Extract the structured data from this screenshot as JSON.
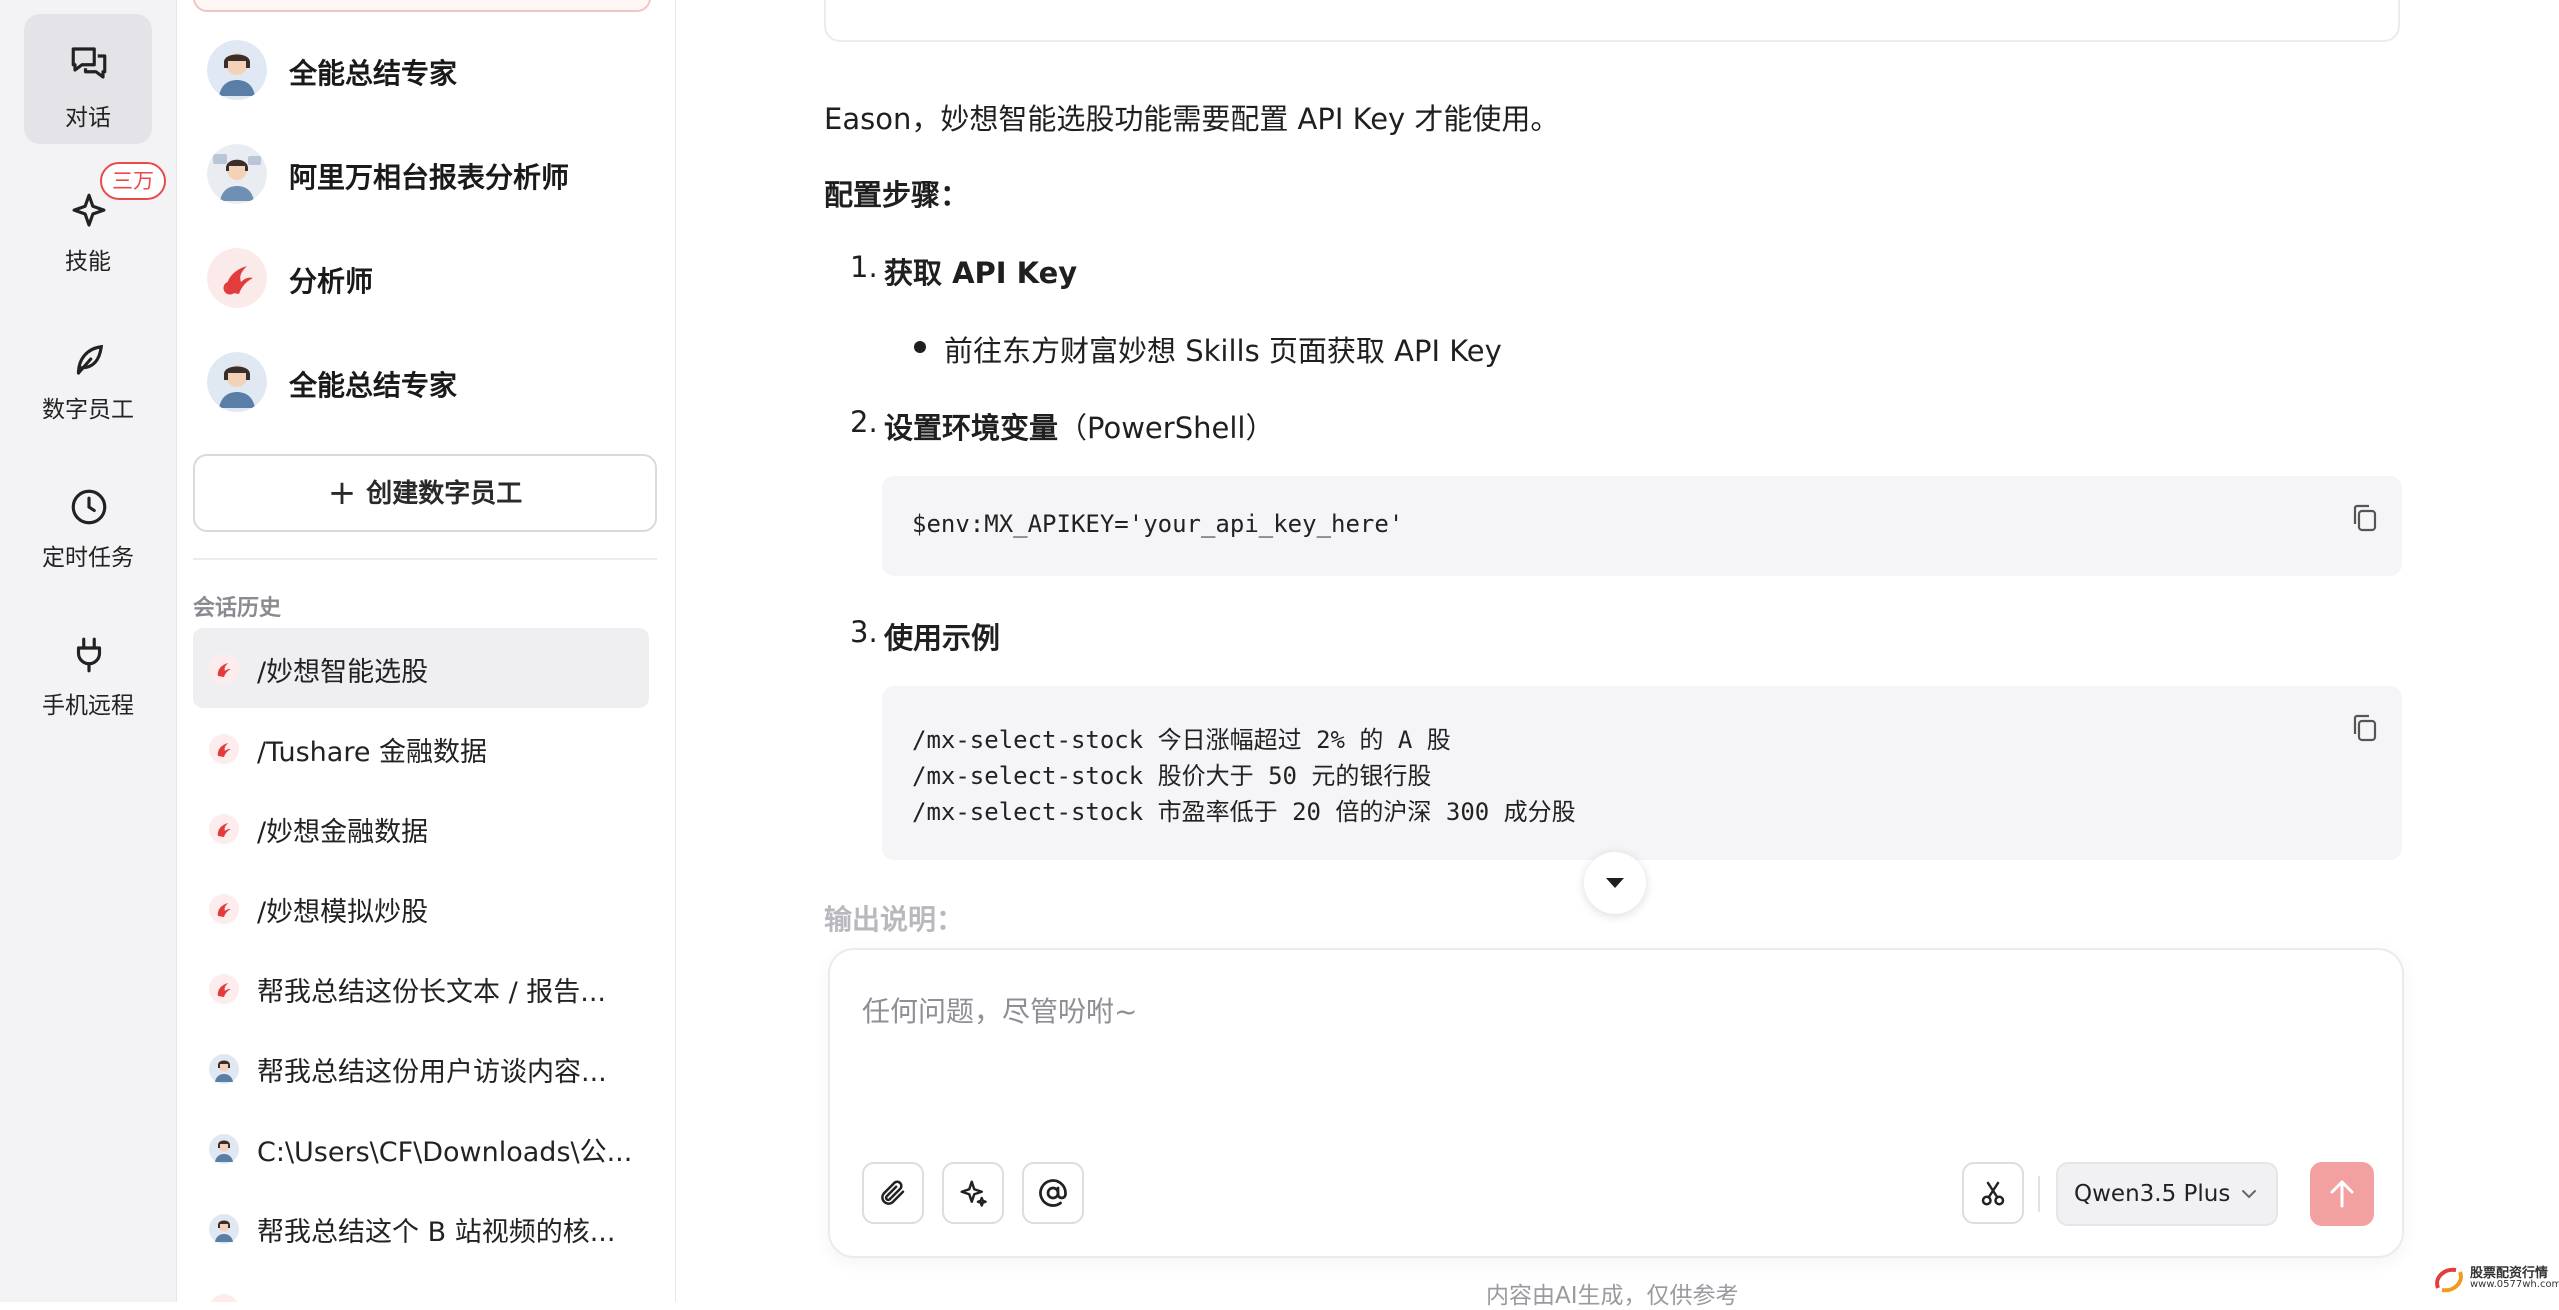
{
  "rail": {
    "items": [
      {
        "label": "对话",
        "icon": "chat-icon"
      },
      {
        "label": "技能",
        "icon": "sparkle-icon"
      },
      {
        "label": "数字员工",
        "icon": "leaf-icon"
      },
      {
        "label": "定时任务",
        "icon": "clock-icon"
      },
      {
        "label": "手机远程",
        "icon": "plug-icon"
      }
    ],
    "skills_badge": "三万"
  },
  "sidebar": {
    "agents": [
      {
        "name": "全能总结专家"
      },
      {
        "name": "阿里万相台报表分析师"
      },
      {
        "name": "分析师"
      },
      {
        "name": "全能总结专家"
      }
    ],
    "create_label": "创建数字员工",
    "history_title": "会话历史",
    "history": [
      {
        "label": "/妙想智能选股",
        "icon": "fire-icon"
      },
      {
        "label": "/Tushare 金融数据",
        "icon": "fire-icon"
      },
      {
        "label": "/妙想金融数据",
        "icon": "fire-icon"
      },
      {
        "label": "/妙想模拟炒股",
        "icon": "fire-icon"
      },
      {
        "label": "帮我总结这份长文本 / 报告...",
        "icon": "fire-icon"
      },
      {
        "label": "帮我总结这份用户访谈内容...",
        "icon": "avatar-icon"
      },
      {
        "label": "C:\\Users\\CF\\Downloads\\公...",
        "icon": "avatar-icon"
      },
      {
        "label": "帮我总结这个 B 站视频的核...",
        "icon": "avatar-icon"
      }
    ]
  },
  "message": {
    "intro": "Eason，妙想智能选股功能需要配置 API Key 才能使用。",
    "steps_title": "配置步骤：",
    "step1_title": "获取 API Key",
    "step1_bullet": "前往东方财富妙想 Skills 页面获取 API Key",
    "step2_title": "设置环境变量",
    "step2_suffix": "（PowerShell）",
    "step2_code": "$env:MX_APIKEY='your_api_key_here'",
    "step3_title": "使用示例",
    "step3_code": [
      "/mx-select-stock 今日涨幅超过 2% 的 A 股",
      "/mx-select-stock 股价大于 50 元的银行股",
      "/mx-select-stock 市盈率低于 20 倍的沪深 300 成分股"
    ],
    "output_title": "输出说明："
  },
  "input": {
    "placeholder": "任何问题，尽管吩咐~",
    "model": "Qwen3.5 Plus"
  },
  "footer_note": "内容由AI生成，仅供参考",
  "watermark": {
    "line1": "股票配资行情",
    "line2": "www.0577wh.com"
  },
  "colors": {
    "accent_red": "#ea4a4a",
    "send_disabled": "#f3a0a0"
  }
}
